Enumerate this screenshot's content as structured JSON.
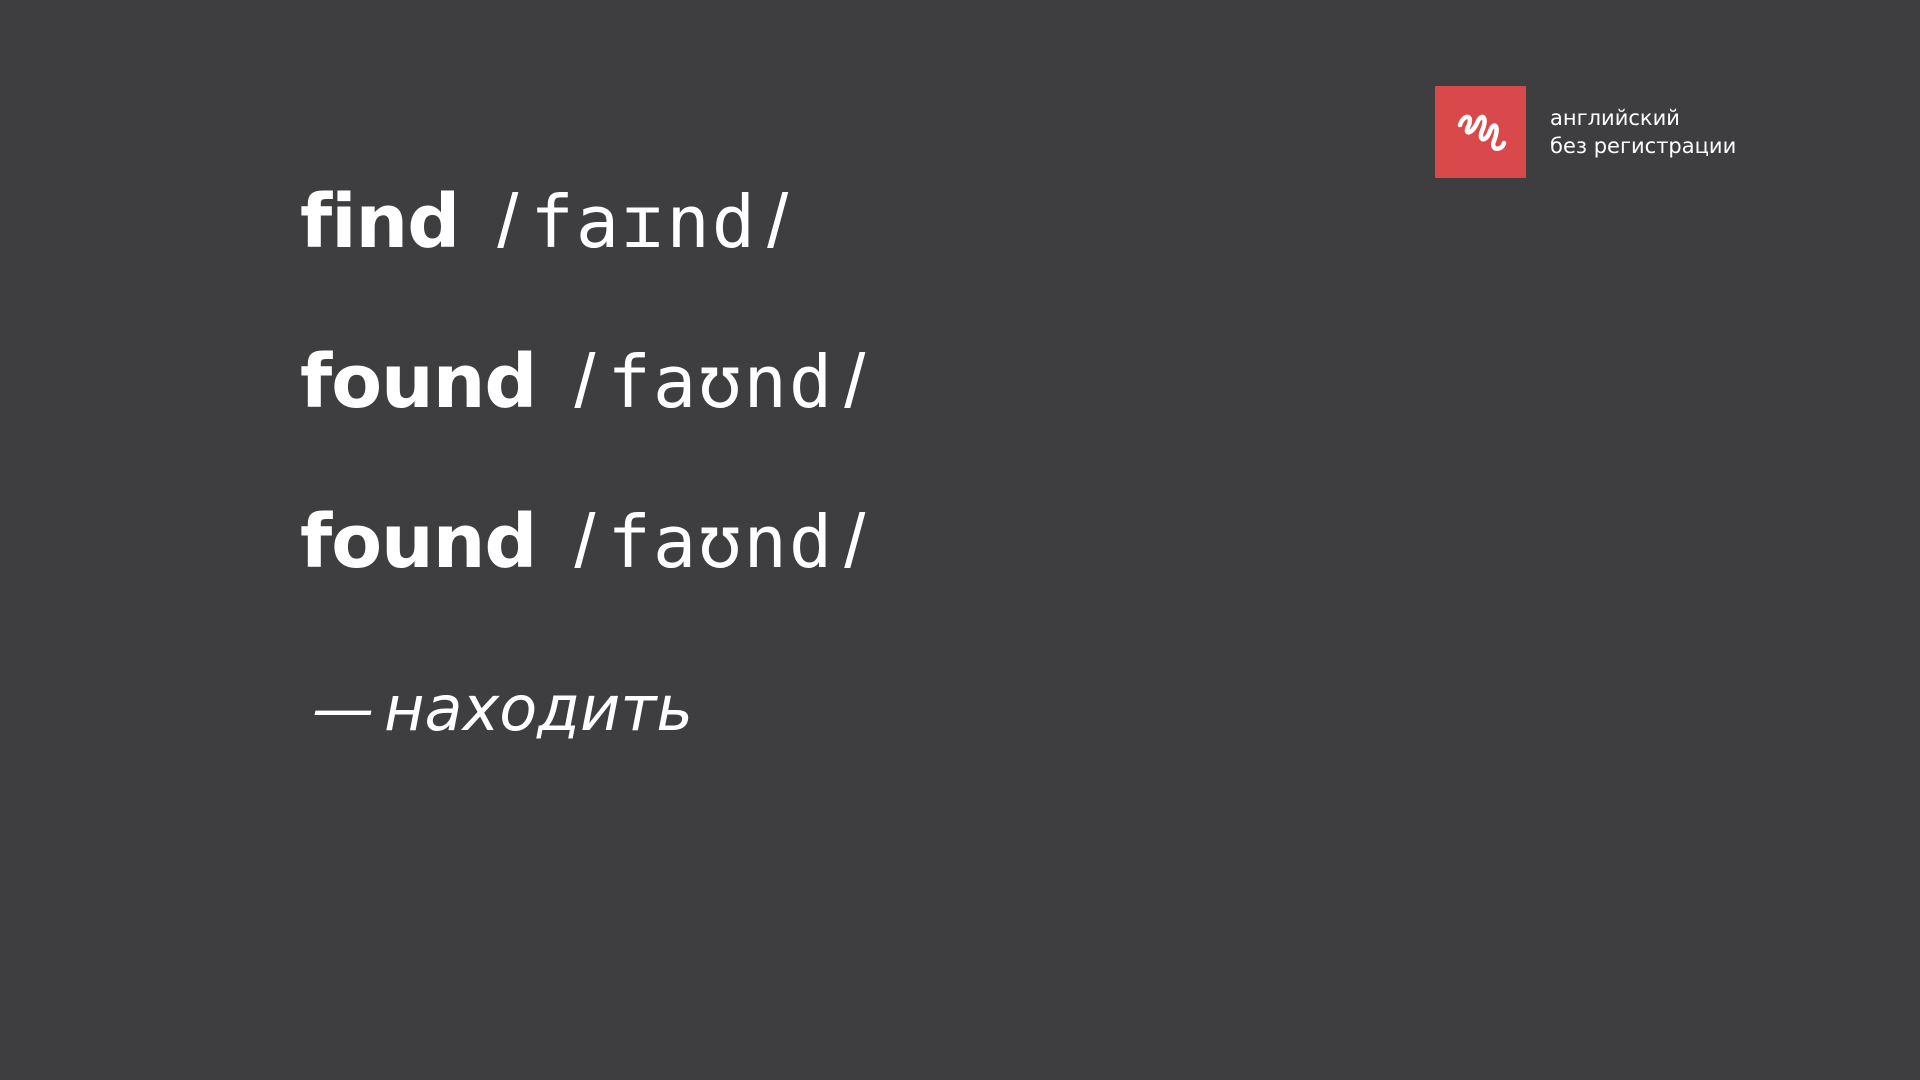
{
  "brand": {
    "line1": "английский",
    "line2": "без регистрации",
    "logo_icon": "squiggle-logo-icon",
    "logo_color": "#d9484a"
  },
  "background_color": "#3e3d40",
  "rows": [
    {
      "word": "find",
      "slash_open": "/",
      "transcription": "faɪnd",
      "slash_close": "/"
    },
    {
      "word": "found",
      "slash_open": "/",
      "transcription": "faʊnd",
      "slash_close": "/"
    },
    {
      "word": "found",
      "slash_open": "/",
      "transcription": "faʊnd",
      "slash_close": "/"
    }
  ],
  "translation": {
    "dash": "—",
    "text": "находить"
  }
}
